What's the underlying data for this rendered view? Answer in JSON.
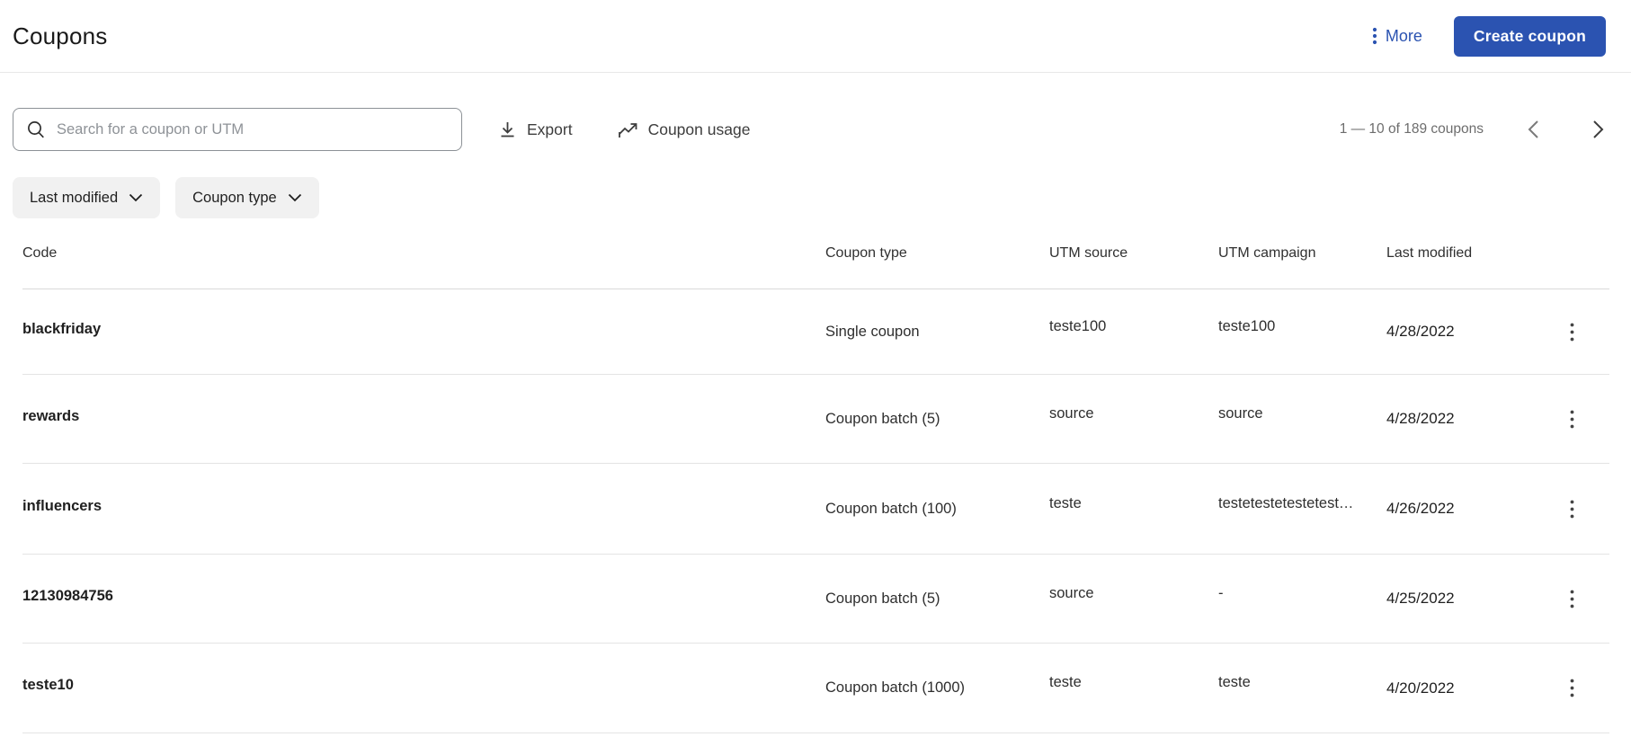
{
  "page": {
    "title": "Coupons"
  },
  "header": {
    "more_label": "More",
    "create_button_label": "Create coupon"
  },
  "toolbar": {
    "search_placeholder": "Search for a coupon or UTM",
    "search_value": "",
    "export_label": "Export",
    "coupon_usage_label": "Coupon usage",
    "pagination_label": "1 — 10 of 189 coupons"
  },
  "filters": [
    {
      "label": "Last modified"
    },
    {
      "label": "Coupon type"
    }
  ],
  "table": {
    "columns": [
      "Code",
      "Coupon type",
      "UTM source",
      "UTM campaign",
      "Last modified"
    ],
    "rows": [
      {
        "code": "blackfriday",
        "type": "Single coupon",
        "utm_source": "teste100",
        "utm_campaign": "teste100",
        "last_modified": "4/28/2022"
      },
      {
        "code": "rewards",
        "type": "Coupon batch (5)",
        "utm_source": "source",
        "utm_campaign": "source",
        "last_modified": "4/28/2022"
      },
      {
        "code": "influencers",
        "type": "Coupon batch (100)",
        "utm_source": "teste",
        "utm_campaign": "testetestetestetest…",
        "last_modified": "4/26/2022"
      },
      {
        "code": "12130984756",
        "type": "Coupon batch (5)",
        "utm_source": "source",
        "utm_campaign": "-",
        "last_modified": "4/25/2022"
      },
      {
        "code": "teste10",
        "type": "Coupon batch (1000)",
        "utm_source": "teste",
        "utm_campaign": "teste",
        "last_modified": "4/20/2022"
      }
    ]
  },
  "icons": {
    "more": "kebab-vertical-icon",
    "search": "magnifier-icon",
    "export": "download-icon",
    "coupon_usage": "trend-line-icon",
    "filter": "chevron-down-icon",
    "prev_page": "chevron-left-icon",
    "next_page": "chevron-right-icon",
    "row_menu": "kebab-vertical-icon"
  },
  "colors": {
    "accent_blue": "#2b53b1",
    "text_primary": "#1f1f1f",
    "text_secondary": "#6d6d6d",
    "chip_background": "#f1f1f1",
    "divider": "#e4e4e4",
    "search_border": "#8c9196"
  }
}
